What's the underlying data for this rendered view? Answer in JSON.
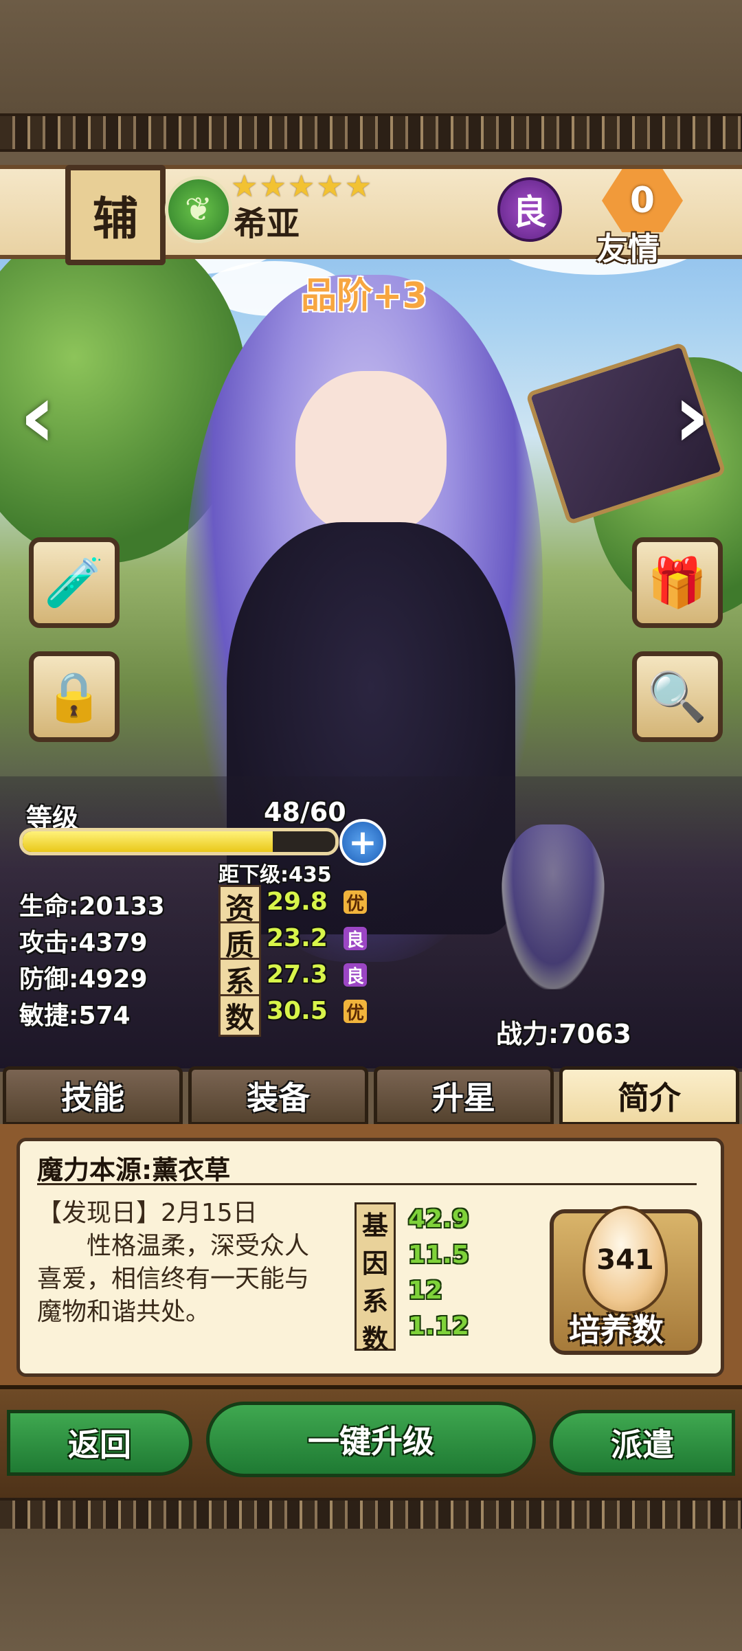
{
  "header": {
    "role": "辅",
    "stars": "★★★★★",
    "hero_name": "希亚",
    "rank": "良",
    "friendship_value": "0",
    "friendship_label": "友情"
  },
  "quality_label": "品阶+3",
  "level": {
    "label": "等级",
    "current": "48/60",
    "fill_fraction": 0.8,
    "to_next": "距下级:435"
  },
  "stats": {
    "hp": "生命:20133",
    "attack": "攻击:4379",
    "defense": "防御:4929",
    "agility": "敏捷:574",
    "aptitude_labels": [
      "资",
      "质",
      "系",
      "数"
    ],
    "aptitude_values": [
      "29.8",
      "23.2",
      "27.3",
      "30.5"
    ],
    "aptitude_grades": [
      "优",
      "良",
      "良",
      "优"
    ],
    "power": "战力:7063"
  },
  "tabs": [
    "技能",
    "装备",
    "升星",
    "简介"
  ],
  "active_tab": "简介",
  "profile": {
    "title": "魔力本源:薰衣草",
    "discovery": "【发现日】2月15日",
    "description": "性格温柔，深受众人喜爱，相信终有一天能与魔物和谐共处。",
    "gene_labels": [
      "基",
      "因",
      "系",
      "数"
    ],
    "gene_values": [
      "42.9",
      "11.5",
      "12",
      "1.12"
    ],
    "breed_count": "341",
    "breed_label": "培养数"
  },
  "actions": {
    "back": "返回",
    "one_click_upgrade": "一键升级",
    "dispatch": "派遣"
  },
  "colors": {
    "grade_you": "#f1b43c",
    "grade_liang": "#9b46c4",
    "accent_green": "#7fd23a",
    "frame_brown": "#4a3220"
  },
  "icons": {
    "left_arrow": "chevron-left-icon",
    "right_arrow": "chevron-right-icon",
    "potion": "potion-icon",
    "gift": "gift-icon",
    "lock": "lock-icon",
    "search": "magnifier-icon",
    "plus": "plus-icon"
  }
}
